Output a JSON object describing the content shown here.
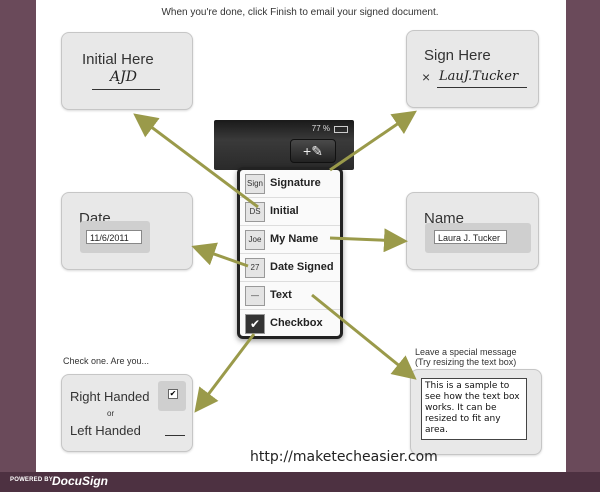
{
  "instructions": "When you're done, click Finish to email your signed document.",
  "cards": {
    "initial": {
      "label": "Initial Here",
      "script": "AJD"
    },
    "sign": {
      "label": "Sign Here",
      "mark": "×",
      "script": "LauJ.Tucker"
    },
    "date": {
      "label": "Date",
      "value": "11/6/2011"
    },
    "name": {
      "label": "Name",
      "value": "Laura J. Tucker"
    },
    "handed": {
      "right": "Right Handed",
      "or": "or",
      "left": "Left Handed"
    }
  },
  "check_prompt": "Check one. Are you...",
  "message_prompt_1": "Leave a special message",
  "message_prompt_2": "(Try resizing the text box)",
  "message_text": "This is a sample to see how the text box works. It can be resized to fit any area.",
  "phone": {
    "battery": "77 %"
  },
  "menu": [
    {
      "label": "Signature",
      "icon": "Sign"
    },
    {
      "label": "Initial",
      "icon": "DS"
    },
    {
      "label": "My Name",
      "icon": "Joe"
    },
    {
      "label": "Date Signed",
      "icon": "27"
    },
    {
      "label": "Text",
      "icon": "—"
    },
    {
      "label": "Checkbox",
      "icon": "✔"
    }
  ],
  "footer": {
    "powered": "POWERED BY",
    "brand": "DocuSign"
  },
  "url": "http://maketecheasier.com",
  "colors": {
    "arrow": "#9a9a4a",
    "frame": "#6a4a5a"
  }
}
